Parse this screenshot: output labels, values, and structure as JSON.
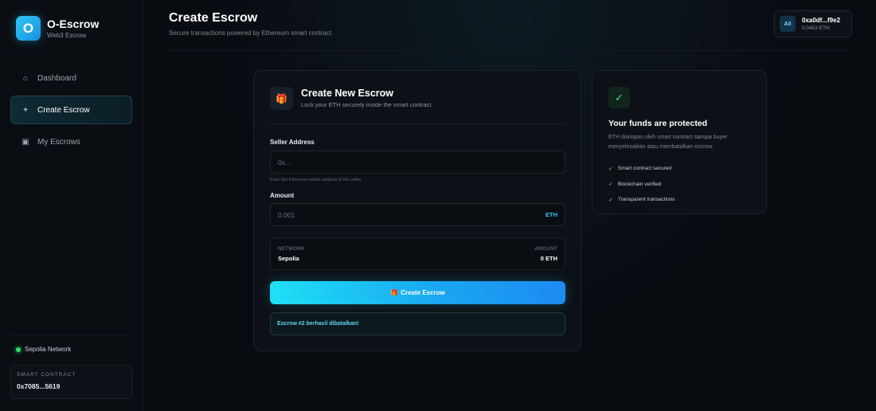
{
  "brand": {
    "logo_letter": "O",
    "name": "O-Escrow",
    "subtitle": "Web3 Escrow",
    "accent": "#2ec8f5"
  },
  "nav": {
    "items": [
      {
        "label": "Dashboard",
        "icon": "home-icon",
        "glyph": "⌂"
      },
      {
        "label": "Create Escrow",
        "icon": "plus-icon",
        "glyph": "+"
      },
      {
        "label": "My Escrows",
        "icon": "square-icon",
        "glyph": "▣"
      }
    ],
    "active": "Create Escrow"
  },
  "network": {
    "label": "Sepolia Network",
    "status_color": "#2fdc6a"
  },
  "contract": {
    "label": "SMART CONTRACT",
    "address": "0x7085...5619"
  },
  "header": {
    "title": "Create Escrow",
    "subtitle": "Secure transactions powered by Ethereum smart contract."
  },
  "wallet": {
    "avatar": "A0",
    "address": "0xa0df...f9e2",
    "balance": "0.0453 ETH"
  },
  "form": {
    "icon": "gift-icon",
    "icon_glyph": "🎁",
    "title": "Create New Escrow",
    "subtitle": "Lock your ETH securely inside the smart contract.",
    "seller": {
      "label": "Seller Address",
      "placeholder": "0x...",
      "value": "",
      "hint": "Enter the Ethereum wallet address of the seller."
    },
    "amount": {
      "label": "Amount",
      "placeholder": "0.001",
      "value": "",
      "unit": "ETH"
    },
    "summary": {
      "network_label": "NETWORK",
      "network_value": "Sepolia",
      "amount_label": "AMOUNT",
      "amount_value": "0 ETH"
    },
    "submit": {
      "icon_glyph": "🎁",
      "label": "Create Escrow"
    },
    "toast": "Escrow #2 berhasil dibatalkan!"
  },
  "info": {
    "icon_glyph": "✓",
    "title": "Your funds are protected",
    "description": "ETH disimpan oleh smart contract sampai buyer menyelesaikan atau membatalkan escrow.",
    "features": [
      "Smart contract secured",
      "Blockchain verified",
      "Transparent transactions"
    ],
    "check_glyph": "✓"
  }
}
